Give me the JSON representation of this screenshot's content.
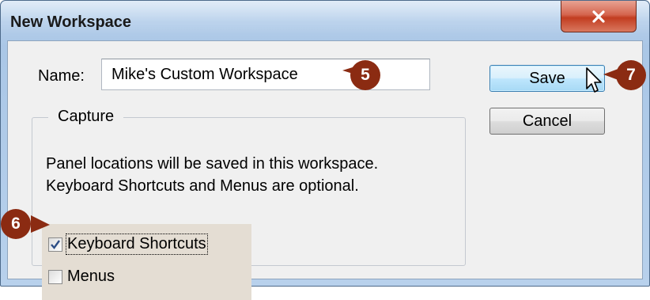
{
  "window": {
    "title": "New Workspace"
  },
  "form": {
    "name_label": "Name:",
    "name_value": "Mike's Custom Workspace"
  },
  "capture": {
    "legend": "Capture",
    "description_line1": "Panel locations will be saved in this workspace.",
    "description_line2": "Keyboard Shortcuts and Menus are optional.",
    "options": [
      {
        "label": "Keyboard Shortcuts",
        "checked": true
      },
      {
        "label": "Menus",
        "checked": false
      }
    ]
  },
  "buttons": {
    "save": "Save",
    "cancel": "Cancel"
  },
  "callouts": [
    "5",
    "6",
    "7"
  ],
  "colors": {
    "callout": "#8b2b12",
    "close_button": "#c94a2e",
    "save_button_border": "#3c7fb1"
  },
  "icons": [
    "close-icon",
    "checkmark-icon",
    "pointer-cursor-icon"
  ]
}
